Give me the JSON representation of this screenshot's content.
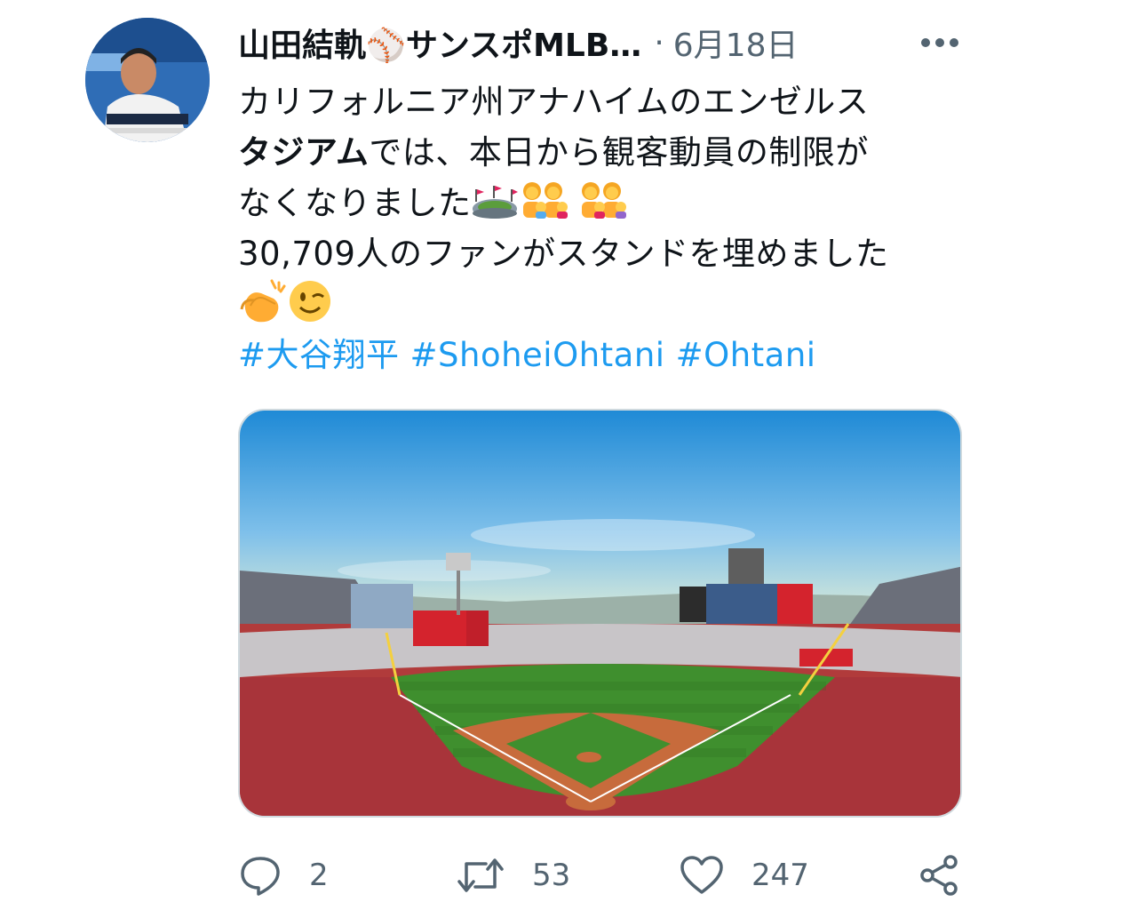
{
  "tweet": {
    "author_name": "山田結軌⚾サンスポMLB…",
    "separator": "·",
    "date": "6月18日",
    "more_icon": "more-horizontal-icon",
    "text_lines": [
      "カリフォルニア州アナハイムのエンゼルス",
      "タジアム",
      "では、本日から観客動員の制限が",
      "なくなりました",
      "30,709人のファンがスタンドを埋めました"
    ],
    "emojis": {
      "stadium": "🏟",
      "family": "👪",
      "clap": "👏",
      "wink": "😉"
    },
    "hashtags": [
      "#大谷翔平",
      "#ShoheiOhtani",
      "#Ohtani"
    ]
  },
  "actions": {
    "reply_count": "2",
    "retweet_count": "53",
    "like_count": "247"
  },
  "colors": {
    "hashtag": "#1d9bf0",
    "muted": "#536471",
    "field_green": "#3f8f2e",
    "dirt": "#c76b3c",
    "sky": "#3a9ad9"
  }
}
